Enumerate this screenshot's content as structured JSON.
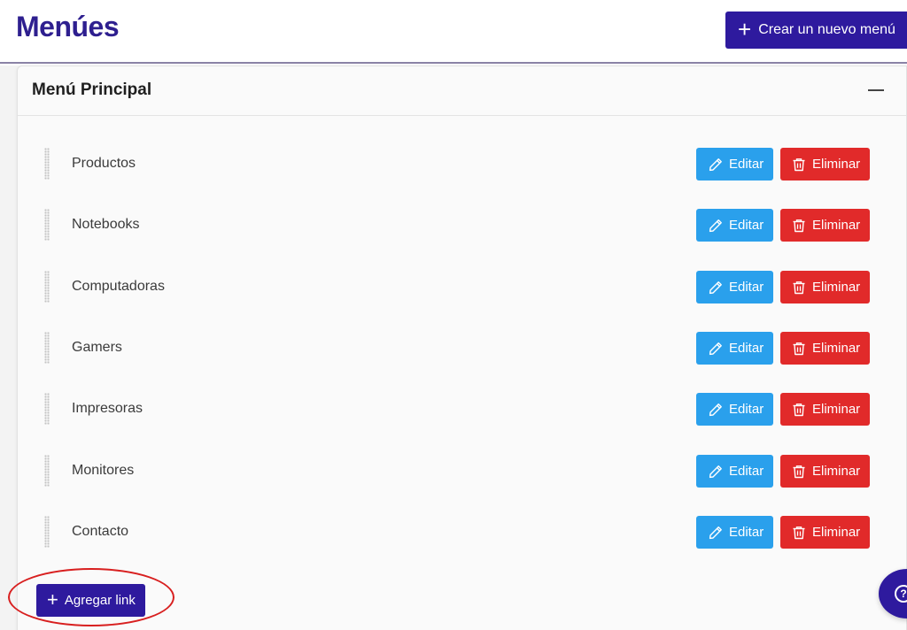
{
  "header": {
    "title": "Menúes",
    "new_menu_button": {
      "label": "Crear un nuevo menú",
      "icon": "plus-icon"
    }
  },
  "card": {
    "title": "Menú Principal",
    "collapse_icon": "minus-icon",
    "items": [
      {
        "label": "Productos",
        "edit_label": "Editar",
        "delete_label": "Eliminar"
      },
      {
        "label": "Notebooks",
        "edit_label": "Editar",
        "delete_label": "Eliminar"
      },
      {
        "label": "Computadoras",
        "edit_label": "Editar",
        "delete_label": "Eliminar"
      },
      {
        "label": "Gamers",
        "edit_label": "Editar",
        "delete_label": "Eliminar"
      },
      {
        "label": "Impresoras",
        "edit_label": "Editar",
        "delete_label": "Eliminar"
      },
      {
        "label": "Monitores",
        "edit_label": "Editar",
        "delete_label": "Eliminar"
      },
      {
        "label": "Contacto",
        "edit_label": "Editar",
        "delete_label": "Eliminar"
      }
    ],
    "add_link_button": {
      "label": "Agregar link",
      "icon": "plus-icon"
    }
  },
  "help_button": {
    "icon": "help-icon"
  },
  "colors": {
    "brand": "#2e1a9e",
    "title": "#2e1f8f",
    "edit": "#2aa0ec",
    "delete": "#e12a2a",
    "annotation": "#d81f1f"
  }
}
